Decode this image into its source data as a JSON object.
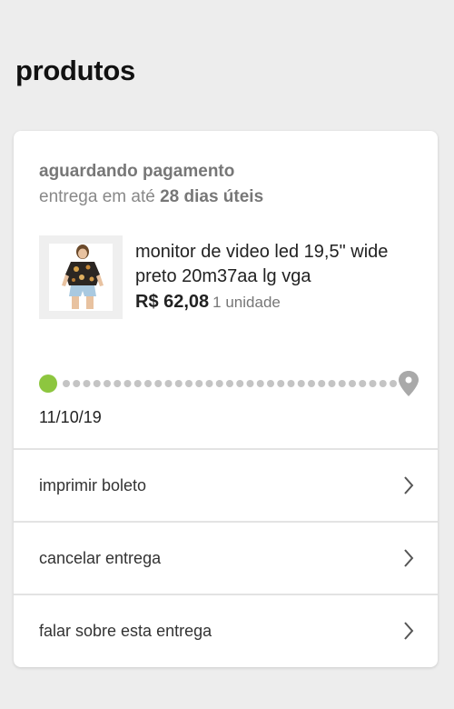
{
  "page": {
    "title": "produtos"
  },
  "order": {
    "status": "aguardando pagamento",
    "delivery_prefix": "entrega em até ",
    "delivery_days": "28 dias úteis",
    "product": {
      "name": "monitor de video led 19,5\" wide preto 20m37aa lg vga",
      "price": "R$ 62,08",
      "quantity": "1 unidade",
      "image_icon": "product-photo"
    },
    "tracking": {
      "date": "11/10/19",
      "progress": 0,
      "start_color": "#8dc63f",
      "dot_color": "#c4c4c4",
      "end_icon": "location-pin-icon"
    }
  },
  "actions": [
    {
      "label": "imprimir boleto",
      "icon": "chevron-right-icon"
    },
    {
      "label": "cancelar entrega",
      "icon": "chevron-right-icon"
    },
    {
      "label": "falar sobre esta entrega",
      "icon": "chevron-right-icon"
    }
  ]
}
